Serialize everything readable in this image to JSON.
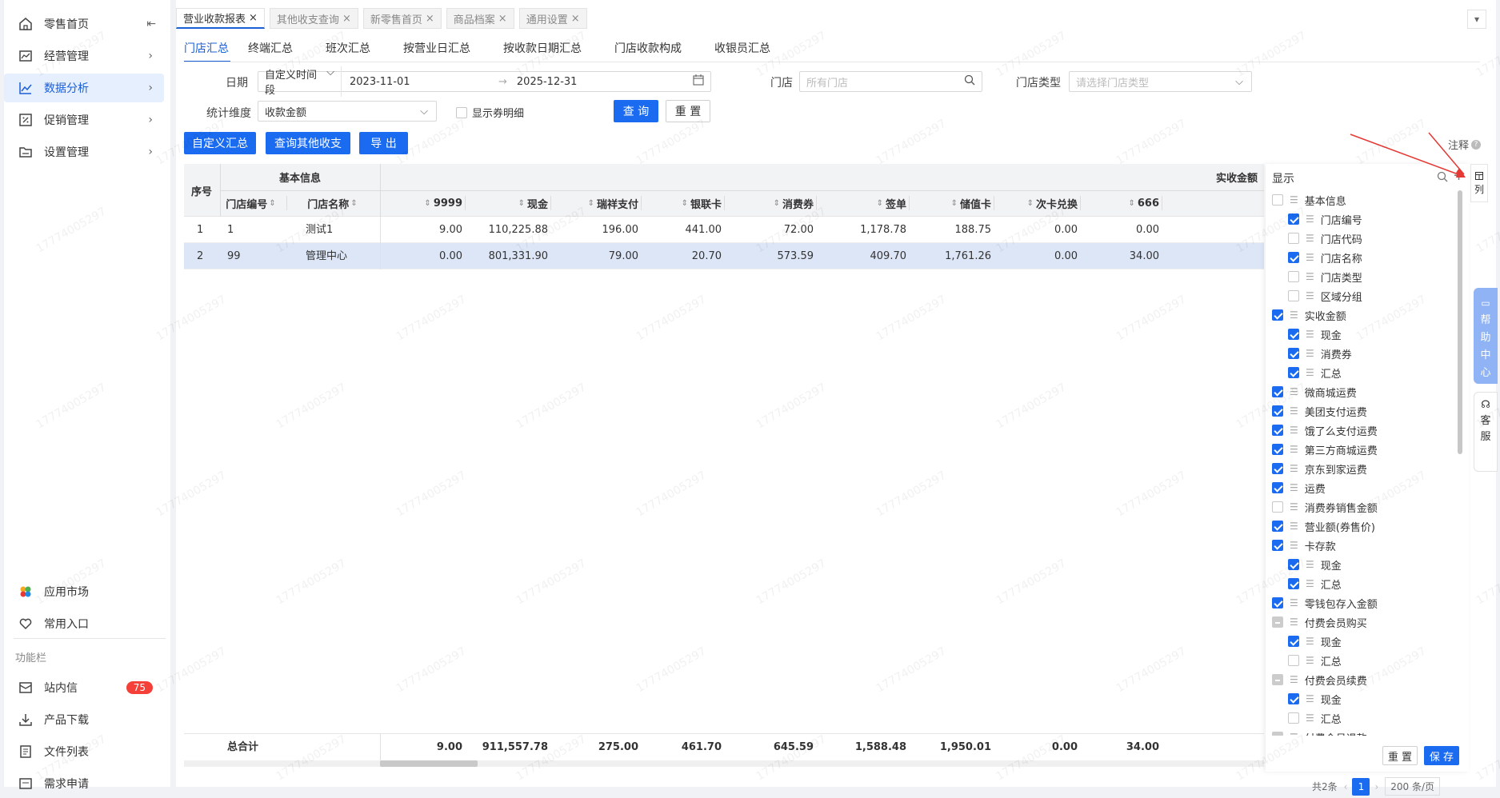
{
  "sidebar": {
    "items": [
      {
        "label": "零售首页",
        "icon": "home-icon"
      },
      {
        "label": "经营管理",
        "icon": "chart-board-icon"
      },
      {
        "label": "数据分析",
        "icon": "trend-chart-icon"
      },
      {
        "label": "促销管理",
        "icon": "coupon-icon"
      },
      {
        "label": "设置管理",
        "icon": "folder-icon"
      }
    ],
    "bottom_items": [
      {
        "label": "应用市场",
        "icon": "app-market-icon"
      },
      {
        "label": "常用入口",
        "icon": "heart-icon"
      }
    ],
    "section_title": "功能栏",
    "func_items": [
      {
        "label": "站内信",
        "icon": "mail-icon",
        "badge": "75"
      },
      {
        "label": "产品下载",
        "icon": "download-icon"
      },
      {
        "label": "文件列表",
        "icon": "file-list-icon"
      },
      {
        "label": "需求申请",
        "icon": "request-icon"
      }
    ],
    "collapse_icon": "⇤"
  },
  "tabs": [
    {
      "label": "营业收款报表",
      "active": true
    },
    {
      "label": "其他收支查询"
    },
    {
      "label": "新零售首页"
    },
    {
      "label": "商品档案"
    },
    {
      "label": "通用设置"
    }
  ],
  "subtabs": [
    "门店汇总",
    "终端汇总",
    "班次汇总",
    "按营业日汇总",
    "按收款日期汇总",
    "门店收款构成",
    "收银员汇总"
  ],
  "filters": {
    "date_label": "日期",
    "date_mode": "自定义时间段",
    "date_start": "2023-11-01",
    "date_end": "2025-12-31",
    "store_label": "门店",
    "store_placeholder": "所有门店",
    "store_type_label": "门店类型",
    "store_type_placeholder": "请选择门店类型",
    "dim_label": "统计维度",
    "dim_value": "收款金额",
    "show_coupon_label": "显示券明细",
    "query_btn": "查 询",
    "reset_btn": "重 置"
  },
  "actions": {
    "custom": "自定义汇总",
    "query_other": "查询其他收支",
    "export": "导 出",
    "note": "注释"
  },
  "table": {
    "group_basic": "基本信息",
    "group_paid": "实收金额",
    "col_seq": "序号",
    "col_store_no": "门店编号",
    "col_store_name": "门店名称",
    "columns": [
      "9999",
      "现金",
      "瑞祥支付",
      "银联卡",
      "消费券",
      "签单",
      "储值卡",
      "次卡兑换",
      "666"
    ],
    "rows": [
      {
        "seq": "1",
        "no": "1",
        "name": "测试1",
        "vals": [
          "9.00",
          "110,225.88",
          "196.00",
          "441.00",
          "72.00",
          "1,178.78",
          "188.75",
          "0.00",
          "0.00"
        ]
      },
      {
        "seq": "2",
        "no": "99",
        "name": "管理中心",
        "vals": [
          "0.00",
          "801,331.90",
          "79.00",
          "20.70",
          "573.59",
          "409.70",
          "1,761.26",
          "0.00",
          "34.00"
        ]
      }
    ],
    "total_label": "总合计",
    "totals": [
      "9.00",
      "911,557.78",
      "275.00",
      "461.70",
      "645.59",
      "1,588.48",
      "1,950.01",
      "0.00",
      "34.00"
    ]
  },
  "panel": {
    "title": "显示",
    "items": [
      {
        "label": "基本信息",
        "level": 0,
        "state": "off"
      },
      {
        "label": "门店编号",
        "level": 1,
        "state": "on"
      },
      {
        "label": "门店代码",
        "level": 1,
        "state": "off"
      },
      {
        "label": "门店名称",
        "level": 1,
        "state": "on"
      },
      {
        "label": "门店类型",
        "level": 1,
        "state": "off"
      },
      {
        "label": "区域分组",
        "level": 1,
        "state": "off"
      },
      {
        "label": "实收金额",
        "level": 0,
        "state": "on"
      },
      {
        "label": "现金",
        "level": 1,
        "state": "on"
      },
      {
        "label": "消费券",
        "level": 1,
        "state": "on"
      },
      {
        "label": "汇总",
        "level": 1,
        "state": "on"
      },
      {
        "label": "微商城运费",
        "level": 0,
        "state": "on"
      },
      {
        "label": "美团支付运费",
        "level": 0,
        "state": "on"
      },
      {
        "label": "饿了么支付运费",
        "level": 0,
        "state": "on"
      },
      {
        "label": "第三方商城运费",
        "level": 0,
        "state": "on"
      },
      {
        "label": "京东到家运费",
        "level": 0,
        "state": "on"
      },
      {
        "label": "运费",
        "level": 0,
        "state": "on"
      },
      {
        "label": "消费券销售金额",
        "level": 0,
        "state": "off"
      },
      {
        "label": "营业额(券售价)",
        "level": 0,
        "state": "on"
      },
      {
        "label": "卡存款",
        "level": 0,
        "state": "on"
      },
      {
        "label": "现金",
        "level": 1,
        "state": "on"
      },
      {
        "label": "汇总",
        "level": 1,
        "state": "on"
      },
      {
        "label": "零钱包存入金额",
        "level": 0,
        "state": "on"
      },
      {
        "label": "付费会员购买",
        "level": 0,
        "state": "half"
      },
      {
        "label": "现金",
        "level": 1,
        "state": "on"
      },
      {
        "label": "汇总",
        "level": 1,
        "state": "off"
      },
      {
        "label": "付费会员续费",
        "level": 0,
        "state": "half"
      },
      {
        "label": "现金",
        "level": 1,
        "state": "on"
      },
      {
        "label": "汇总",
        "level": 1,
        "state": "off"
      },
      {
        "label": "付费会员退款",
        "level": 0,
        "state": "half"
      }
    ],
    "reset_btn": "重 置",
    "save_btn": "保 存"
  },
  "column_btn": "列",
  "help_center": [
    "帮",
    "助",
    "中",
    "心"
  ],
  "customer_service": [
    "客",
    "服"
  ],
  "pager": {
    "total": "共2条",
    "page": "1",
    "size": "200 条/页"
  },
  "watermark": "17774005297",
  "colors": {
    "primary": "#1a6bf0",
    "selected_row": "#dce6f7",
    "badge": "#f5403a"
  }
}
